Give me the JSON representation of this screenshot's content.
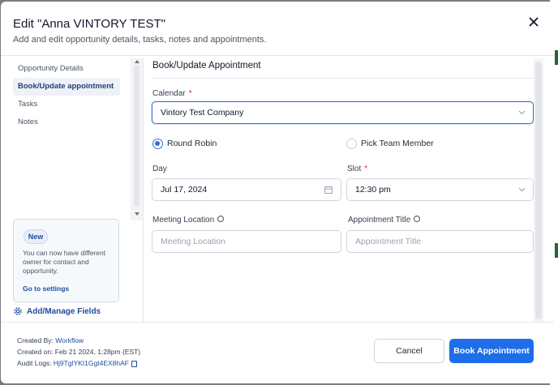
{
  "modal": {
    "title": "Edit \"Anna VINTORY TEST\"",
    "subtitle": "Add and edit opportunity details, tasks, notes and appointments."
  },
  "sidebar": {
    "items": [
      {
        "label": "Opportunity Details",
        "active": false
      },
      {
        "label": "Book/Update appointment",
        "active": true
      },
      {
        "label": "Tasks",
        "active": false
      },
      {
        "label": "Notes",
        "active": false
      }
    ],
    "card": {
      "badge": "New",
      "text": "You can now have different owner for contact and opportunity.",
      "link": "Go to settings"
    },
    "add_manage": "Add/Manage Fields"
  },
  "form": {
    "section_title": "Book/Update Appointment",
    "calendar": {
      "label": "Calendar",
      "required": "*",
      "value": "Vintory Test Company"
    },
    "assignment": {
      "options": [
        {
          "label": "Round Robin",
          "selected": true
        },
        {
          "label": "Pick Team Member",
          "selected": false
        }
      ]
    },
    "day": {
      "label": "Day",
      "value": "Jul 17, 2024"
    },
    "slot": {
      "label": "Slot",
      "required": "*",
      "value": "12:30 pm"
    },
    "meeting_location": {
      "label": "Meeting Location",
      "placeholder": "Meeting Location"
    },
    "appointment_title": {
      "label": "Appointment Title",
      "placeholder": "Appointment Title"
    }
  },
  "footer": {
    "created_by_label": "Created By:",
    "created_by_value": "Workflow",
    "created_on": "Created on: Feb 21 2024, 1:28pm (EST)",
    "audit_label": "Audit Logs:",
    "audit_value": "Hj9TglYKI1Ggt4EX8hAF",
    "cancel": "Cancel",
    "book": "Book Appointment"
  },
  "colors": {
    "primary": "#1d6ee8",
    "link": "#1e4d9a",
    "required": "#dc2626"
  },
  "icons": [
    "close-icon",
    "gear-icon",
    "info-icon",
    "calendar-icon",
    "chevron-down-icon",
    "copy-icon"
  ]
}
